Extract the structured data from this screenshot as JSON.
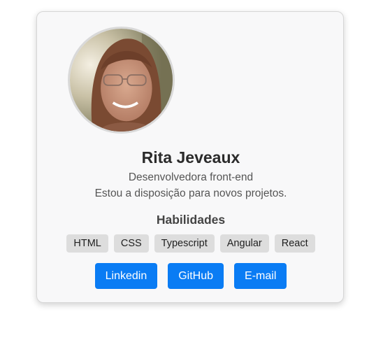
{
  "profile": {
    "name": "Rita Jeveaux",
    "role": "Desenvolvedora front-end",
    "bio": "Estou a disposição para novos projetos."
  },
  "skills": {
    "title": "Habilidades",
    "items": [
      "HTML",
      "CSS",
      "Typescript",
      "Angular",
      "React"
    ]
  },
  "links": {
    "items": [
      "Linkedin",
      "GitHub",
      "E-mail"
    ]
  },
  "colors": {
    "accent": "#0a7cf4",
    "card_background": "#f8f8f9",
    "skill_background": "#dddddd"
  }
}
